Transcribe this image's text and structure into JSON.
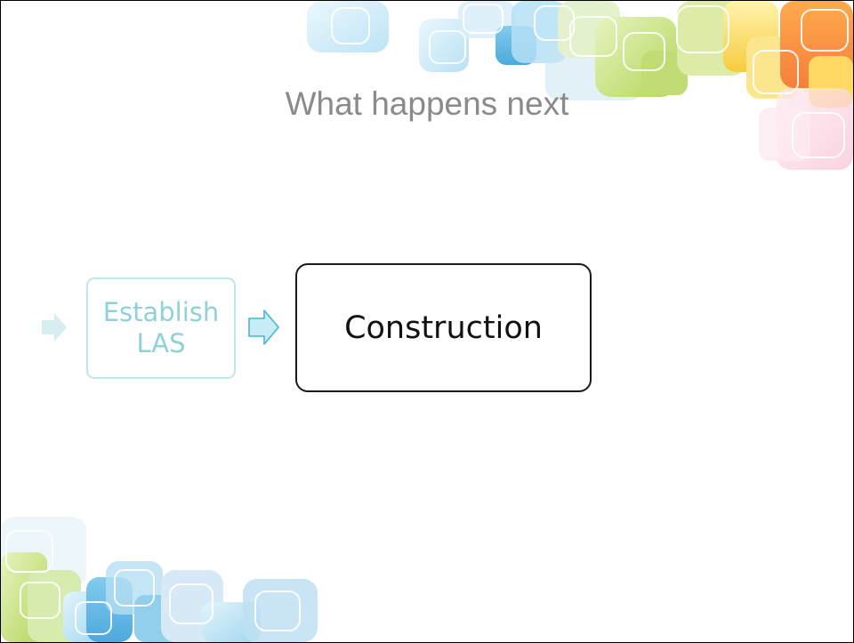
{
  "slide": {
    "title": "What happens next"
  },
  "diagram": {
    "steps": [
      {
        "label_line1": "Establish",
        "label_line2": "LAS",
        "state": "faded"
      },
      {
        "label": "Construction",
        "state": "current"
      }
    ]
  },
  "colors": {
    "title": "#8a8a8a",
    "faded_step_border": "#bfe6ea",
    "faded_step_text": "#8fd1d8",
    "current_step_border": "#1a1a1a",
    "arrow_faded": "#d6eef1",
    "arrow_active_fill": "#c8ecf6",
    "arrow_active_stroke": "#46b5d8"
  }
}
